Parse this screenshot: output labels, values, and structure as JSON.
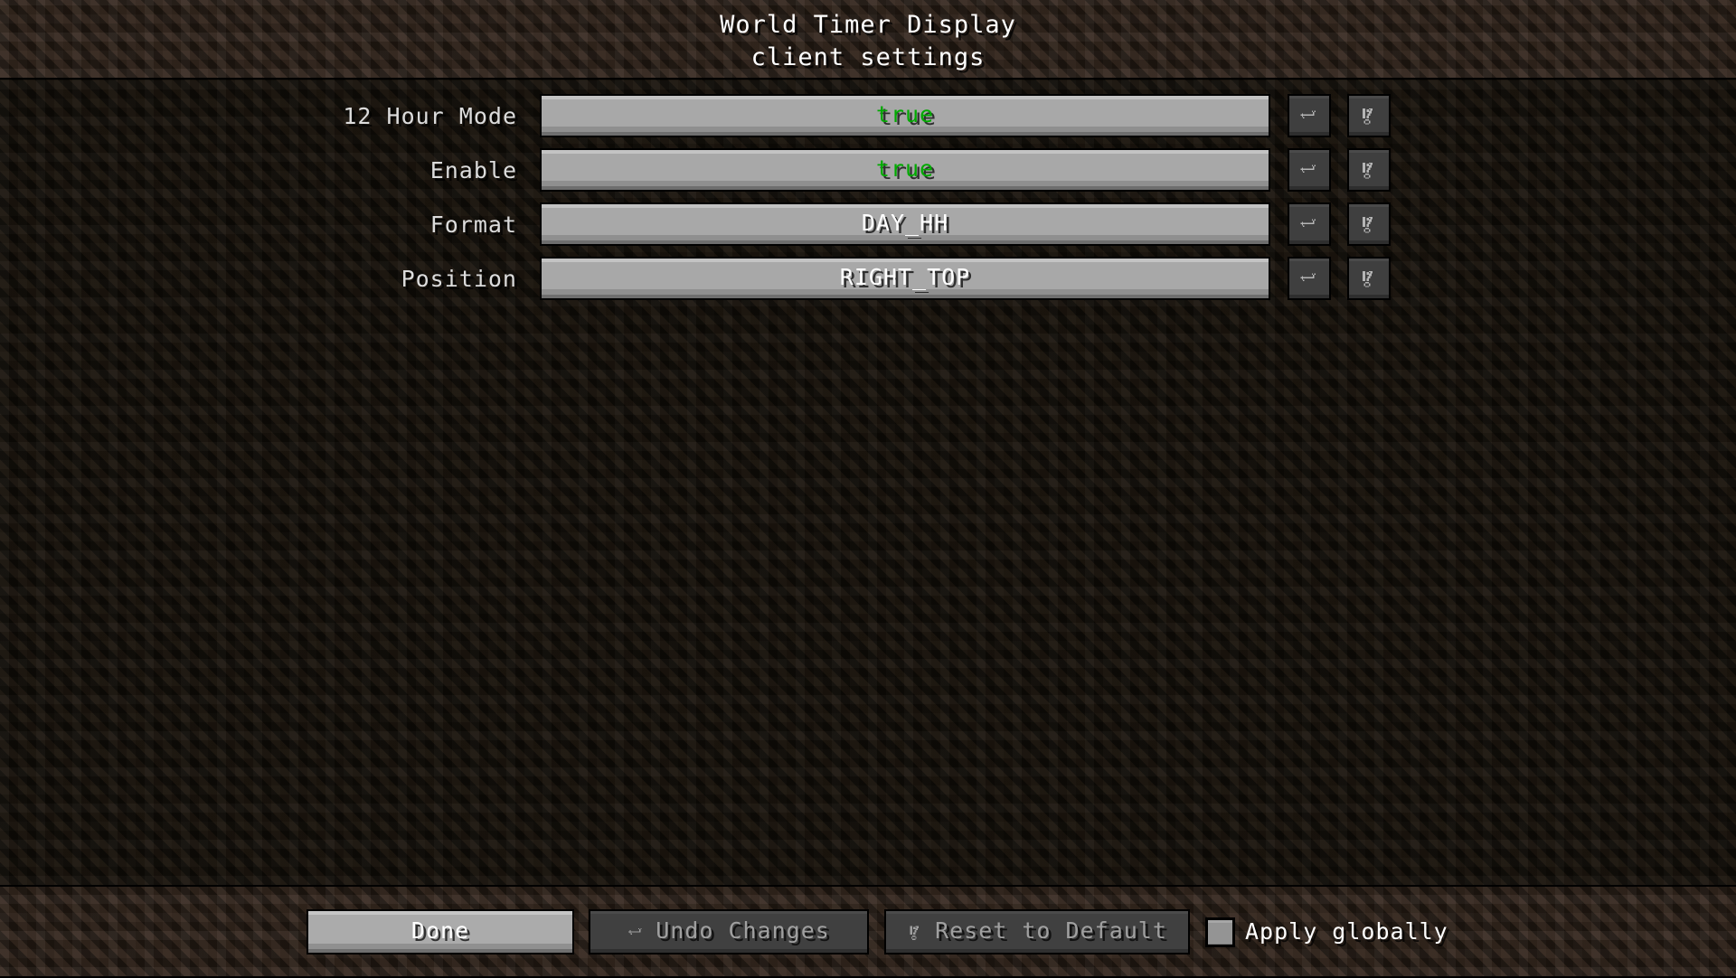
{
  "header": {
    "title": "World Timer Display",
    "subtitle": "client settings"
  },
  "colors": {
    "boolean_true": "#00AA00",
    "enum_value": "#FFFFFF",
    "label": "#DCDCDC",
    "disabled_label": "#A0A0A0",
    "header_dirt": "#2B2018",
    "content_dirt": "#141009",
    "widget_stone": "#A8A8A8",
    "widget_dark": "#3F3F3F"
  },
  "rows": [
    {
      "label": "12 Hour Mode",
      "value": "true",
      "value_kind": "bool-true",
      "undo_icon": "undo-arrow-icon",
      "reset_icon": "reset-to-default-icon"
    },
    {
      "label": "Enable",
      "value": "true",
      "value_kind": "bool-true",
      "undo_icon": "undo-arrow-icon",
      "reset_icon": "reset-to-default-icon"
    },
    {
      "label": "Format",
      "value": "DAY_HH",
      "value_kind": "enum",
      "undo_icon": "undo-arrow-icon",
      "reset_icon": "reset-to-default-icon"
    },
    {
      "label": "Position",
      "value": "RIGHT_TOP",
      "value_kind": "enum",
      "undo_icon": "undo-arrow-icon",
      "reset_icon": "reset-to-default-icon"
    }
  ],
  "footer": {
    "done_label": "Done",
    "undo_changes_label": "Undo Changes",
    "undo_changes_icon": "undo-arrow-icon",
    "reset_label": "Reset to Default",
    "reset_icon": "reset-to-default-icon",
    "apply_globally_label": "Apply globally",
    "apply_globally_checked": false
  }
}
